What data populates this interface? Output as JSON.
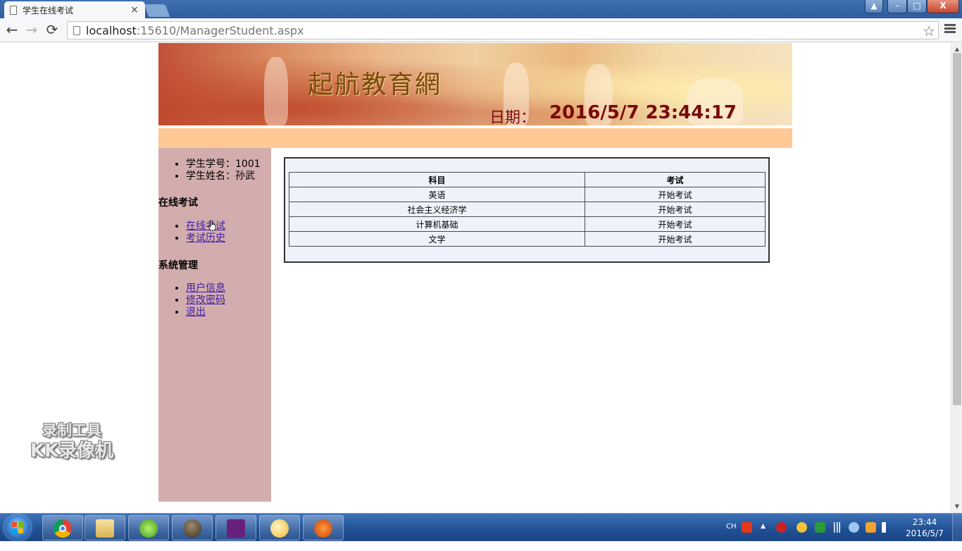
{
  "browser": {
    "tab_title": "学生在线考试",
    "tab_close": "×",
    "url_host": "localhost",
    "url_path": ":15610/ManagerStudent.aspx",
    "back_glyph": "←",
    "forward_glyph": "→",
    "reload_glyph": "⟳",
    "star_glyph": "☆",
    "window_buttons": {
      "user": "▲",
      "minimize": "–",
      "maximize": "□",
      "close": "X"
    }
  },
  "banner": {
    "logo": "起航教育網",
    "date_label": "日期：",
    "date_value": "2016/5/7 23:44:17"
  },
  "sidebar": {
    "student_info": [
      "学生学号：1001",
      "学生姓名：孙武"
    ],
    "exam_section": {
      "title": "在线考试",
      "links": [
        "在线考试",
        "考试历史"
      ]
    },
    "system_section": {
      "title": "系统管理",
      "links": [
        "用户信息",
        "修改密码",
        "退出"
      ]
    }
  },
  "exam_table": {
    "headers": [
      "科目",
      "考试"
    ],
    "rows": [
      [
        "英语",
        "开始考试"
      ],
      [
        "社会主义经济学",
        "开始考试"
      ],
      [
        "计算机基础",
        "开始考试"
      ],
      [
        "文学",
        "开始考试"
      ]
    ]
  },
  "watermark": {
    "line1": "录制工具",
    "line2": "KK录像机"
  },
  "taskbar": {
    "apps": [
      "chrome-icon",
      "file-explorer-icon",
      "game-icon",
      "seal-icon",
      "visual-studio-icon",
      "paint-icon",
      "mascot-icon"
    ],
    "tray_lang": "CH",
    "tray_up": "▲",
    "clock_time": "23:44",
    "clock_date": "2016/5/7"
  },
  "colors": {
    "sidebar_bg": "#d3adad",
    "orange_bar": "#ffc895",
    "table_bg": "#eef2fb",
    "link": "#3c1da6",
    "date_text": "#7a0a0a"
  }
}
